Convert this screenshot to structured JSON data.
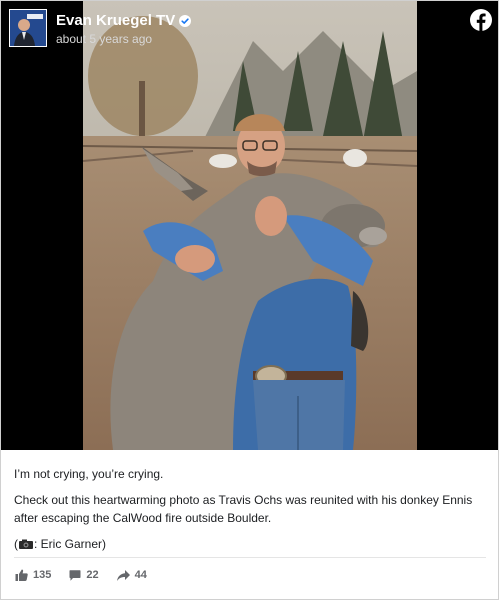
{
  "header": {
    "page_name": "Evan Kruegel TV",
    "timestamp": "about 5 years ago"
  },
  "icons": {
    "verified": "verified-badge-icon",
    "logo": "facebook-logo-icon",
    "like": "thumbs-up-icon",
    "comment": "comment-icon",
    "share": "share-arrow-icon",
    "camera": "camera-icon"
  },
  "post": {
    "line1": "I’m not crying, you’re crying.",
    "line2": "Check out this heartwarming photo as Travis Ochs was reunited with his donkey Ennis after escaping the CalWood fire outside Boulder.",
    "credit_open": "(",
    "credit_text": ": Eric Garner)"
  },
  "stats": {
    "likes": "135",
    "comments": "22",
    "shares": "44"
  },
  "colors": {
    "facebook_blue": "#1877f2",
    "stat_gray": "#65676b"
  }
}
